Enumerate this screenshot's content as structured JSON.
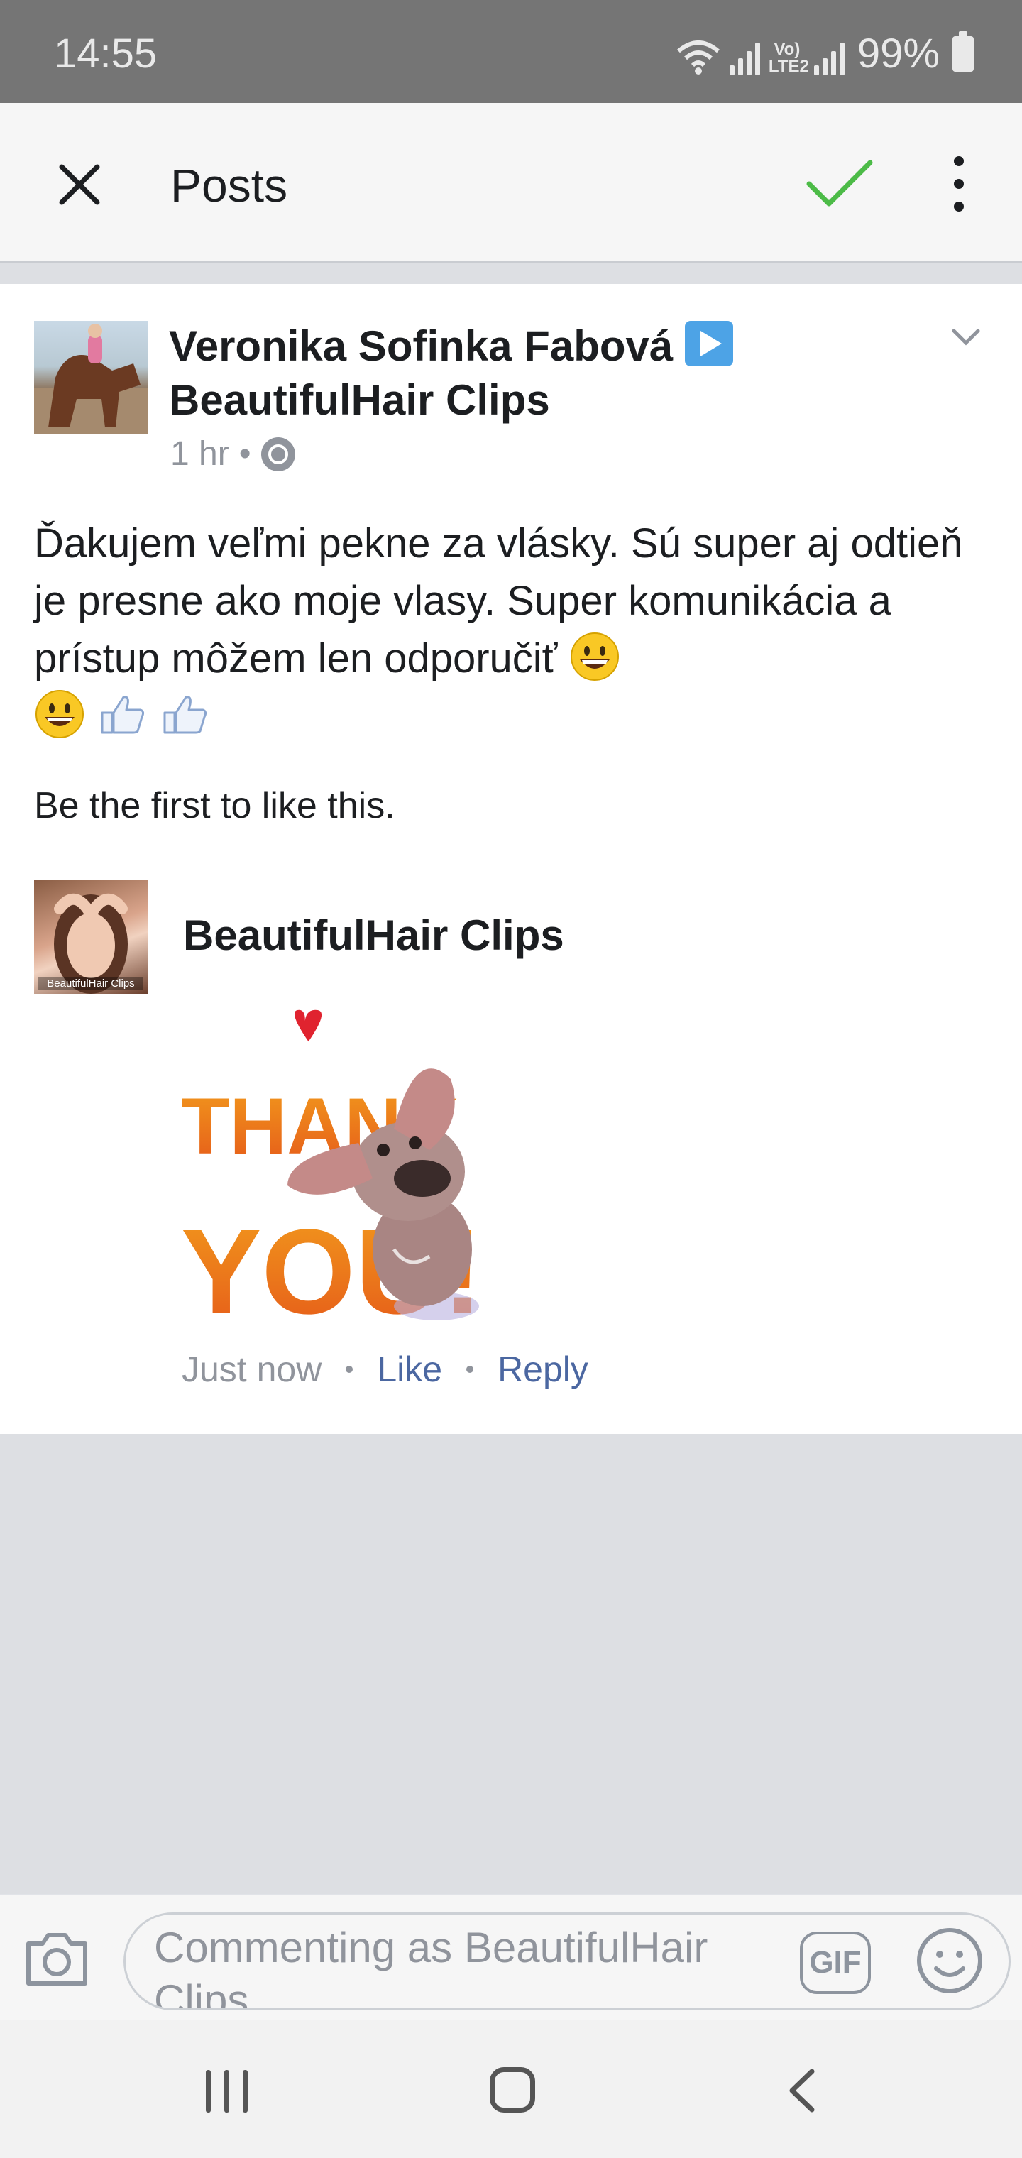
{
  "status_bar": {
    "time": "14:55",
    "network_label": "Vo) LTE2",
    "battery": "99%"
  },
  "app_bar": {
    "title": "Posts",
    "icons": [
      "close-icon",
      "checkmark-icon",
      "more-vert-icon"
    ],
    "accent_check": "#4cbb47"
  },
  "post": {
    "author_line1": "Veronika Sofinka Fabová",
    "author_line2": "BeautifulHair Clips",
    "time": "1 hr",
    "separator": "•",
    "text": "Ďakujem veľmi pekne za vlásky. Sú super aj odtieň je presne ako moje vlasy. Super komunikácia a prístup môžem len odporučiť",
    "likes_text": "Be the first to like this."
  },
  "comment": {
    "author": "BeautifulHair Clips",
    "avatar_watermark": "BeautifulHair Clips",
    "sticker_text_1": "THANK",
    "sticker_text_2": "YOU!",
    "time": "Just now",
    "like_label": "Like",
    "reply_label": "Reply"
  },
  "composer": {
    "placeholder": "Commenting as BeautifulHair Clips",
    "gif_label": "GIF"
  },
  "colors": {
    "status_bar": "#757575",
    "link": "#4b67a1",
    "meta": "#90949c",
    "background": "#dddfe3"
  }
}
